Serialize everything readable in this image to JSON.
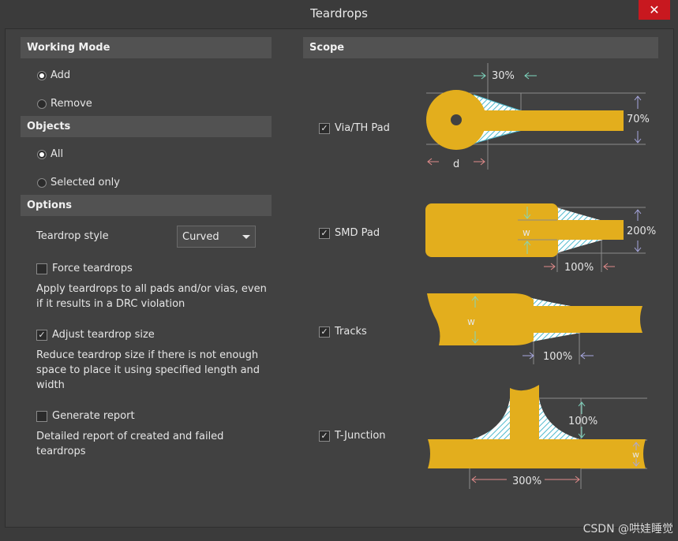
{
  "window": {
    "title": "Teardrops",
    "close_glyph": "✕"
  },
  "working_mode": {
    "header": "Working Mode",
    "options": [
      {
        "label": "Add",
        "selected": true
      },
      {
        "label": "Remove",
        "selected": false
      }
    ]
  },
  "objects": {
    "header": "Objects",
    "options": [
      {
        "label": "All",
        "selected": true
      },
      {
        "label": "Selected only",
        "selected": false
      }
    ]
  },
  "options": {
    "header": "Options",
    "teardrop_style_label": "Teardrop style",
    "teardrop_style_value": "Curved",
    "force": {
      "label": "Force teardrops",
      "checked": false,
      "description_lines": [
        "Apply teardrops to all pads and/or vias, even",
        "if it results in a DRC violation"
      ]
    },
    "adjust": {
      "label": "Adjust teardrop size",
      "checked": true,
      "description_lines": [
        "Reduce teardrop size if there is not enough",
        "space to place it using specified length and",
        "width"
      ]
    },
    "report": {
      "label": "Generate report",
      "checked": false,
      "description_lines": [
        "Detailed report of created and failed",
        "teardrops"
      ]
    }
  },
  "scope": {
    "header": "Scope",
    "items": [
      {
        "label": "Via/TH Pad",
        "checked": true
      },
      {
        "label": "SMD Pad",
        "checked": true
      },
      {
        "label": "Tracks",
        "checked": true
      },
      {
        "label": "T-Junction",
        "checked": true
      }
    ],
    "diagrams": {
      "via": {
        "length": "30%",
        "width": "70%",
        "d": "d"
      },
      "smd": {
        "width": "200%",
        "length": "100%",
        "w": "w"
      },
      "tracks": {
        "w": "w",
        "length": "100%"
      },
      "tjunction": {
        "length": "100%",
        "width": "300%",
        "w": "w"
      }
    }
  },
  "colors": {
    "copper": "#e3ae1d",
    "hatch": "#88d8e4",
    "panel": "#414141",
    "header": "#525252",
    "close": "#c8181f"
  },
  "watermark": "CSDN @哄娃睡觉"
}
